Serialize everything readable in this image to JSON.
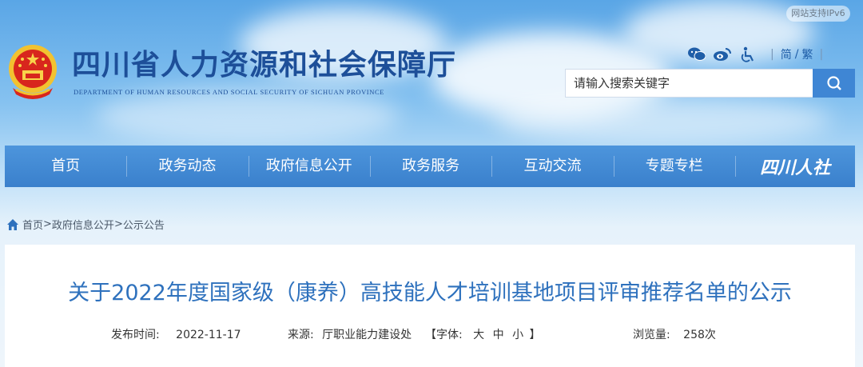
{
  "ipv6_badge": "网站支持IPv6",
  "site": {
    "title": "四川省人力资源和社会保障厅",
    "subtitle": "DEPARTMENT OF HUMAN RESOURCES AND SOCIAL SECURITY OF SICHUAN PROVINCE"
  },
  "tools": {
    "icons": [
      "wechat-icon",
      "weibo-icon",
      "accessibility-icon"
    ],
    "lang_simplified": "简",
    "lang_sep": "/",
    "lang_traditional": "繁",
    "divider": "|"
  },
  "search": {
    "placeholder": "请输入搜索关键字"
  },
  "nav": {
    "items": [
      "首页",
      "政务动态",
      "政府信息公开",
      "政务服务",
      "互动交流",
      "专题专栏"
    ],
    "brand": "四川人社"
  },
  "breadcrumb": {
    "home": "首页",
    "sep": ">",
    "level2": "政府信息公开",
    "level3": "公示公告"
  },
  "article": {
    "title": "关于2022年度国家级（康养）高技能人才培训基地项目评审推荐名单的公示",
    "publish_label": "发布时间:",
    "publish_date": "2022-11-17",
    "source_label": "来源:",
    "source": "厅职业能力建设处",
    "font_label_open": "【字体:",
    "font_large": "大",
    "font_medium": "中",
    "font_small": "小",
    "font_label_close": "】",
    "views_label": "浏览量:",
    "views": "258次"
  },
  "colors": {
    "nav": "#3f86d4",
    "title": "#1d4f99",
    "article_title": "#2e71bd"
  }
}
